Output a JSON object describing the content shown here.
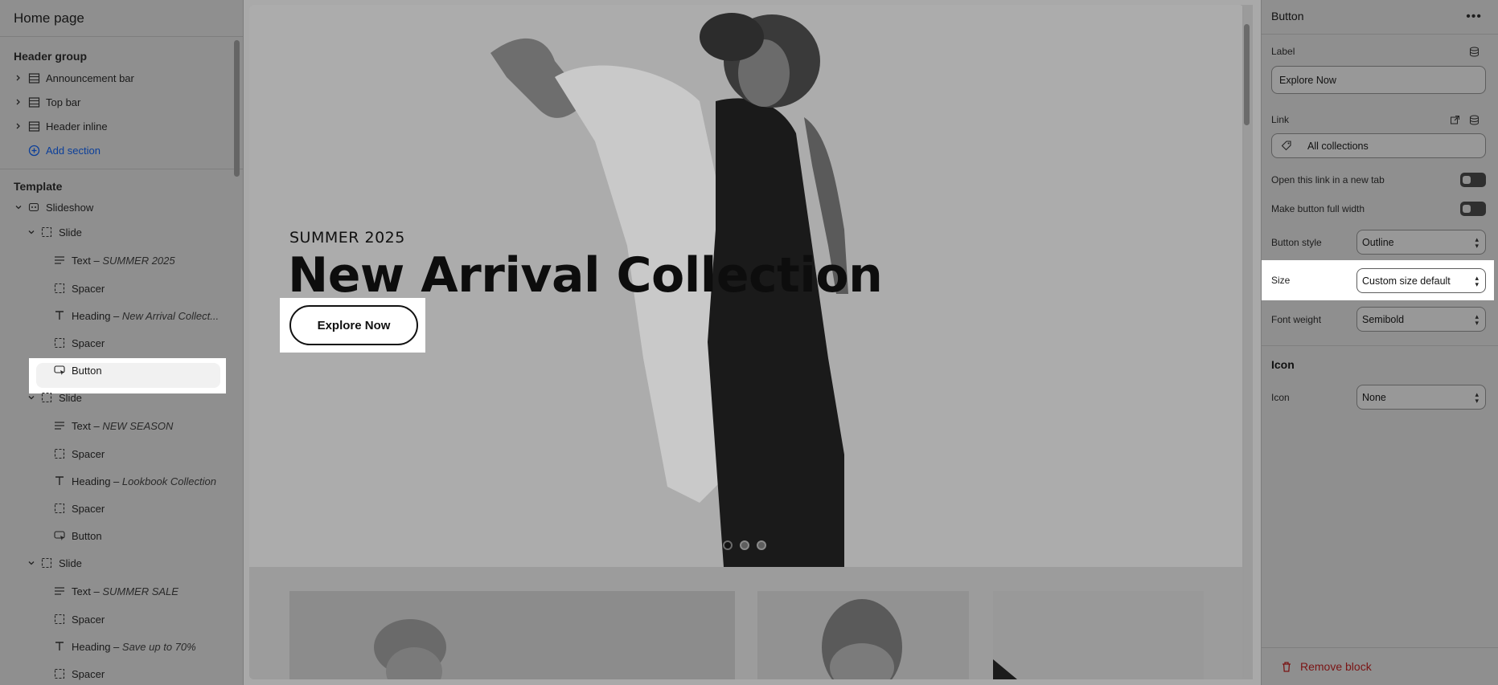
{
  "sidebar": {
    "title": "Home page",
    "header_group": {
      "title": "Header group",
      "items": [
        {
          "label": "Announcement bar"
        },
        {
          "label": "Top bar"
        },
        {
          "label": "Header inline"
        }
      ],
      "add_label": "Add section"
    },
    "template": {
      "title": "Template",
      "section_label": "Slideshow",
      "slides": [
        {
          "label": "Slide",
          "blocks": [
            {
              "label": "Text",
              "sub": "SUMMER 2025"
            },
            {
              "label": "Spacer",
              "sub": ""
            },
            {
              "label": "Heading",
              "sub": "New Arrival Collect..."
            },
            {
              "label": "Spacer",
              "sub": ""
            },
            {
              "label": "Button",
              "sub": ""
            }
          ]
        },
        {
          "label": "Slide",
          "blocks": [
            {
              "label": "Text",
              "sub": "NEW SEASON"
            },
            {
              "label": "Spacer",
              "sub": ""
            },
            {
              "label": "Heading",
              "sub": "Lookbook Collection"
            },
            {
              "label": "Spacer",
              "sub": ""
            },
            {
              "label": "Button",
              "sub": ""
            }
          ]
        },
        {
          "label": "Slide",
          "blocks": [
            {
              "label": "Text",
              "sub": "SUMMER SALE"
            },
            {
              "label": "Spacer",
              "sub": ""
            },
            {
              "label": "Heading",
              "sub": "Save up to 70%"
            },
            {
              "label": "Spacer",
              "sub": ""
            }
          ]
        }
      ]
    },
    "separator": " – "
  },
  "preview": {
    "subheading": "SUMMER 2025",
    "heading": "New Arrival Collection",
    "button_label": "Explore Now",
    "slide_count": 3,
    "active_slide": 1
  },
  "panel": {
    "title": "Button",
    "label_field": {
      "label": "Label",
      "value": "Explore Now"
    },
    "link_field": {
      "label": "Link",
      "value": "All collections"
    },
    "new_tab": {
      "label": "Open this link in a new tab",
      "checked": false
    },
    "full_width": {
      "label": "Make button full width",
      "checked": false
    },
    "button_style": {
      "label": "Button style",
      "value": "Outline"
    },
    "size": {
      "label": "Size",
      "value": "Custom size default"
    },
    "font_weight": {
      "label": "Font weight",
      "value": "Semibold"
    },
    "icon_section": "Icon",
    "icon": {
      "label": "Icon",
      "value": "None"
    },
    "remove_label": "Remove block"
  },
  "colors": {
    "accent_link": "#0b3f9a",
    "remove": "#7a1414",
    "highlight": "#ffffff"
  }
}
